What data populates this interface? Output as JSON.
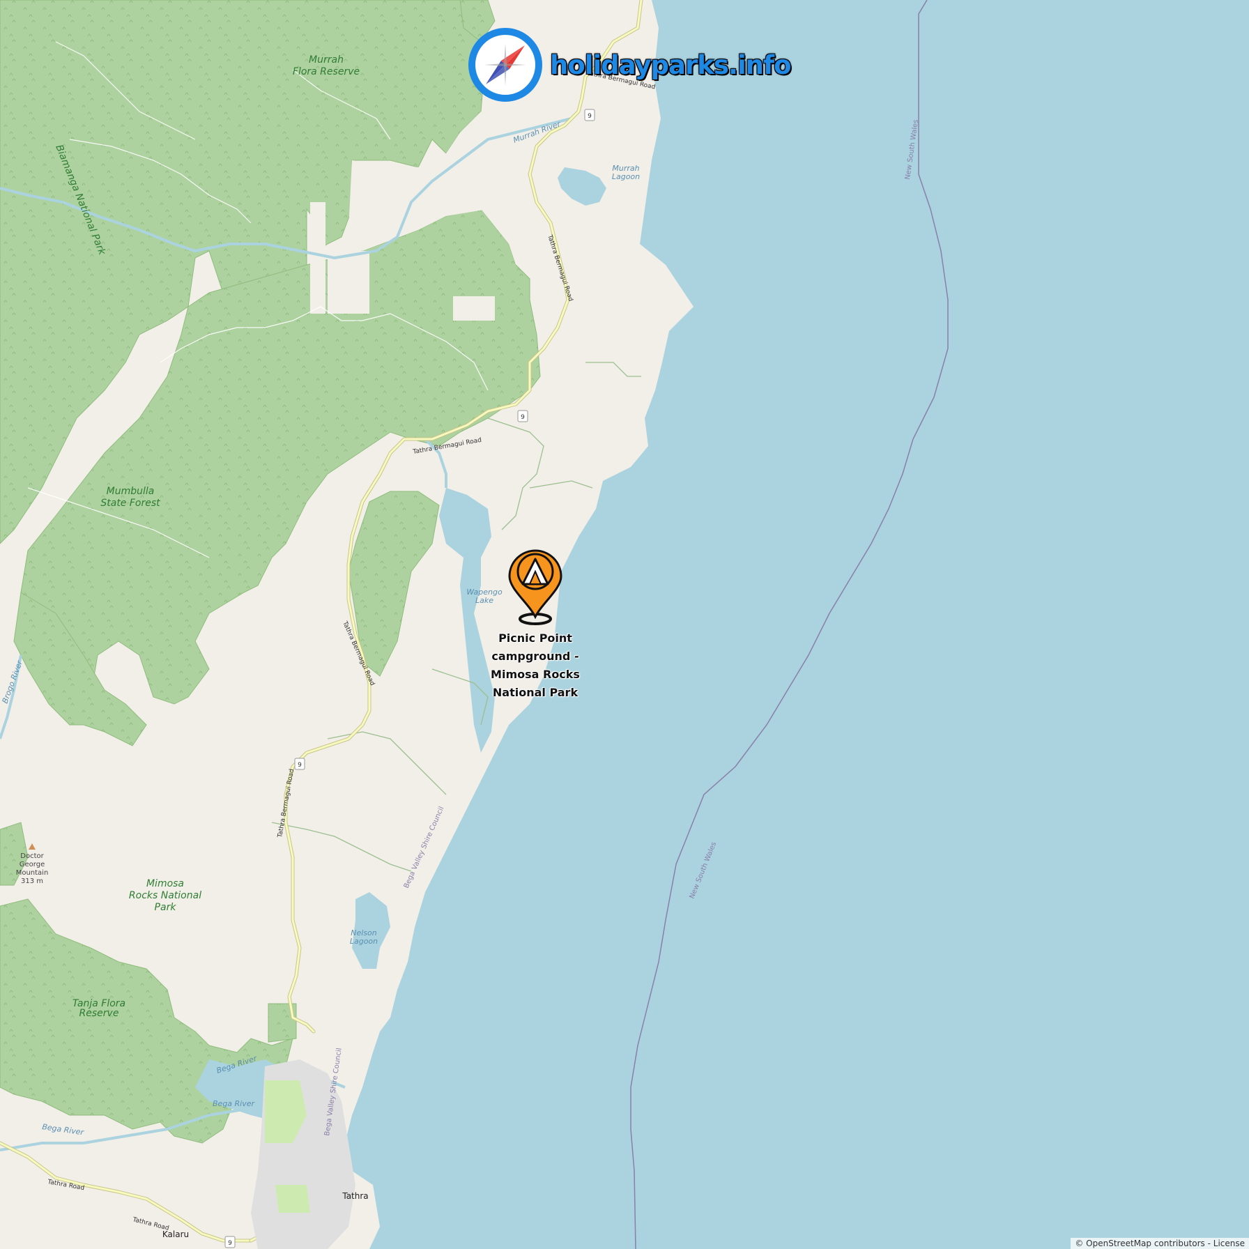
{
  "brand": {
    "name": "holidayparks.info",
    "icon": "compass-icon",
    "accent": "#1e88e5"
  },
  "poi": {
    "name": "Picnic Point campground - Mimosa Rocks National Park",
    "icon": "campground-marker-icon",
    "color": "#f7941d"
  },
  "labels": {
    "murrah_flora": [
      "Murrah",
      "Flora Reserve"
    ],
    "biamanga": "Biamanga National Park",
    "mumbulla": [
      "Mumbulla",
      "State Forest"
    ],
    "mimosa_rocks": [
      "Mimosa",
      "Rocks National",
      "Park"
    ],
    "tanja_flora": [
      "Tanja Flora",
      "Reserve"
    ],
    "murrah_river": "Murrah River",
    "murrah_lagoon": [
      "Murrah",
      "Lagoon"
    ],
    "wapengo_lake": [
      "Wapengo",
      "Lake"
    ],
    "nelson_lagoon": [
      "Nelson",
      "Lagoon"
    ],
    "bega_river": "Bega River",
    "brogo_river": "Brogo River",
    "nsw_border": "New South Wales",
    "bega_valley": "Bega Valley Shire Council",
    "tathra_bermagui_road": "Tathra Bermagui Road",
    "tathra_road": "Tathra Road",
    "tathra": "Tathra",
    "kalaru": "Kalaru",
    "doctor_george": [
      "Doctor",
      "George",
      "Mountain",
      "313 m"
    ],
    "route_9": "9"
  },
  "attribution": "© OpenStreetMap contributors - License",
  "colors": {
    "sea": "#aad3df",
    "land": "#f2efe9",
    "forest": "#aed1a0",
    "water": "#aad3df",
    "road": "#f7fabf",
    "border": "#8a7fa8"
  }
}
